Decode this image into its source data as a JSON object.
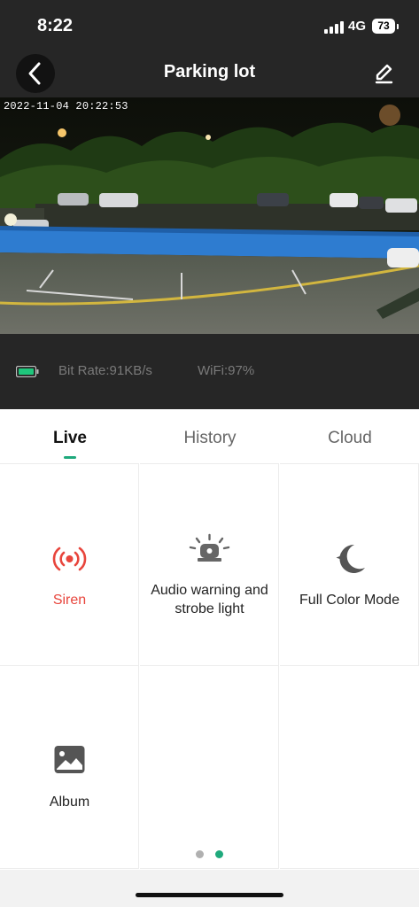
{
  "status_bar": {
    "time": "8:22",
    "network": "4G",
    "battery": "73"
  },
  "header": {
    "title": "Parking lot"
  },
  "video": {
    "timestamp": "2022-11-04 20:22:53"
  },
  "stream_info": {
    "bit_rate": "Bit Rate:91KB/s",
    "wifi": "WiFi:97%"
  },
  "tabs": [
    {
      "label": "Live",
      "active": true
    },
    {
      "label": "History",
      "active": false
    },
    {
      "label": "Cloud",
      "active": false
    }
  ],
  "grid": {
    "siren": {
      "label": "Siren",
      "color": "#e8453c"
    },
    "audio_warning": {
      "label_line1": "Audio warning and",
      "label_line2": "strobe light"
    },
    "full_color": {
      "label": "Full Color Mode"
    },
    "album": {
      "label": "Album"
    }
  },
  "pager": {
    "pages": 2,
    "current": 2,
    "active_color": "#1fa97c",
    "inactive_color": "#b0b0b0"
  },
  "colors": {
    "accent": "#1fa97c",
    "header_bg": "#262626"
  }
}
